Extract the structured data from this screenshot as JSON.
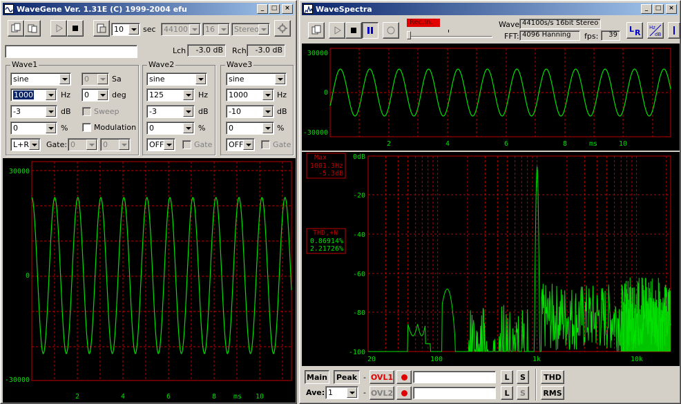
{
  "wavegene": {
    "title": "WaveGene  Ver. 1.31E  (C) 1999-2004 efu",
    "toolbar": {
      "duration": "10",
      "duration_unit": "sec",
      "sample_rate": "44100",
      "bits": "16",
      "channels": "Stereo"
    },
    "levels": {
      "lch_label": "Lch",
      "lch_value": "-3.0 dB",
      "rch_label": "Rch",
      "rch_value": "-3.0 dB"
    },
    "wave1": {
      "title": "Wave1",
      "type": "sine",
      "freq": "1000",
      "freq_unit": "Hz",
      "level": "-3",
      "level_unit": "dB",
      "offset": "0",
      "offset_unit": "%",
      "channel": "L+R",
      "sa_value": "0",
      "sa_label": "Sa",
      "phase": "0",
      "phase_unit": "deg",
      "sweep_label": "Sweep",
      "modulation_label": "Modulation",
      "gate_label": "Gate:",
      "gate1": "0",
      "gate2": "0"
    },
    "wave2": {
      "title": "Wave2",
      "type": "sine",
      "freq": "125",
      "freq_unit": "Hz",
      "level": "-3",
      "level_unit": "dB",
      "offset": "0",
      "offset_unit": "%",
      "switch": "OFF",
      "gate_label": "Gate"
    },
    "wave3": {
      "title": "Wave3",
      "type": "sine",
      "freq": "1000",
      "freq_unit": "Hz",
      "level": "-10",
      "level_unit": "dB",
      "offset": "0",
      "offset_unit": "%",
      "switch": "OFF",
      "gate_label": "Gate"
    },
    "scope": {
      "y_labels": [
        "30000",
        "0",
        "-30000"
      ],
      "x_labels": [
        "2",
        "4",
        "6",
        "8",
        "10"
      ],
      "x_unit": "ms"
    }
  },
  "wavespectra": {
    "title": "WaveSpectra",
    "rec_label": "Rec.In.",
    "wave_label": "Wave:",
    "wave_value": "44100s/s 16bit Stereo",
    "fft_label": "FFT:",
    "fft_value": "4096 Hanning",
    "fps_label": "fps:",
    "fps_value": "39",
    "scope": {
      "y_labels": [
        "30000",
        "0",
        "-30000"
      ],
      "x_labels": [
        "2",
        "4",
        "6",
        "8",
        "10"
      ],
      "x_unit": "ms"
    },
    "spectrum": {
      "y_labels": [
        "0dB",
        "-20",
        "-40",
        "-60",
        "-80",
        "-100"
      ],
      "x_labels": [
        "20",
        "100",
        "1k",
        "10k"
      ],
      "max_label": "Max",
      "max_freq": "1001.3Hz",
      "max_level": "-5.3dB",
      "thd_label": "THD,+N",
      "thd_value": "0.86914%",
      "thdn_value": "2.21726%"
    },
    "bottom": {
      "main_label": "Main",
      "peak_label": "Peak",
      "dash1": "-",
      "ovl1": "OVL1",
      "ave_label": "Ave:",
      "ave_value": "1",
      "dash2": "-",
      "ovl2": "OVL2",
      "l_label": "L",
      "s_label": "S",
      "thd_btn": "THD",
      "rms_btn": "RMS"
    }
  },
  "colors": {
    "trace": "#00e000",
    "grid": "#c00000",
    "axis_text": "#00e000",
    "title_gradient_start": "#0a246a"
  }
}
